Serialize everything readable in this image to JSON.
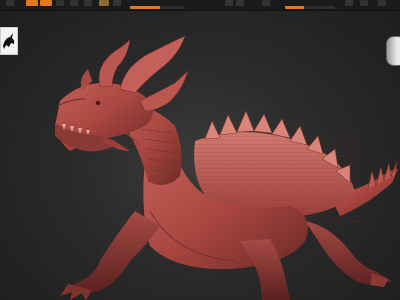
{
  "app": {
    "accent_color": "#e07a1c",
    "model_color": "#a8463f"
  },
  "toolbar": {
    "left_buttons": [
      "",
      ""
    ],
    "labels": [
      "",
      "",
      "",
      ""
    ],
    "slider_a_value": 0.55,
    "slider_b_value": 0.38
  },
  "dock": {
    "logo_icon": "dragon-logo-icon"
  },
  "viewport": {
    "model": "dragon-sculpt",
    "navigator_icon": "view-navigator-icon"
  }
}
